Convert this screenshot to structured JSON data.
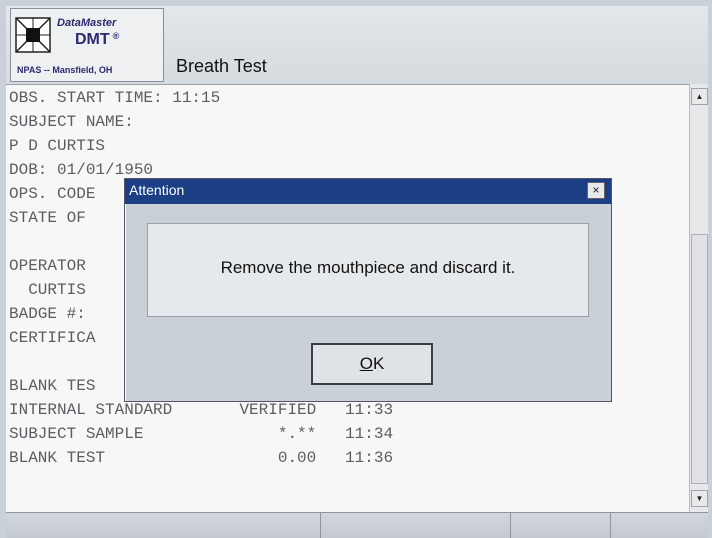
{
  "header": {
    "brand": "DataMaster",
    "model": "DMT",
    "registered_mark": "®",
    "location": "NPAS -- Mansfield, OH",
    "title": "Breath Test"
  },
  "record_lines": [
    "OBS. START TIME: 11:15",
    "SUBJECT NAME:",
    "P D CURTIS",
    "DOB: 01/01/1950",
    "OPS. CODE",
    "STATE OF",
    "",
    "OPERATOR",
    "  CURTIS",
    "BADGE #:",
    "CERTIFICA",
    "",
    "BLANK TES",
    "INTERNAL STANDARD       VERIFIED   11:33",
    "SUBJECT SAMPLE              *.**   11:34",
    "BLANK TEST                  0.00   11:36"
  ],
  "dialog": {
    "title": "Attention",
    "close_symbol": "×",
    "message": "Remove the mouthpiece and discard it.",
    "ok_label_underlined": "O",
    "ok_label_rest": "K"
  },
  "scrollbar": {
    "up_symbol": "▲",
    "down_symbol": "▼"
  },
  "colors": {
    "dialog_titlebar": "#1b3f82",
    "brand_text": "#2c2a6e"
  }
}
